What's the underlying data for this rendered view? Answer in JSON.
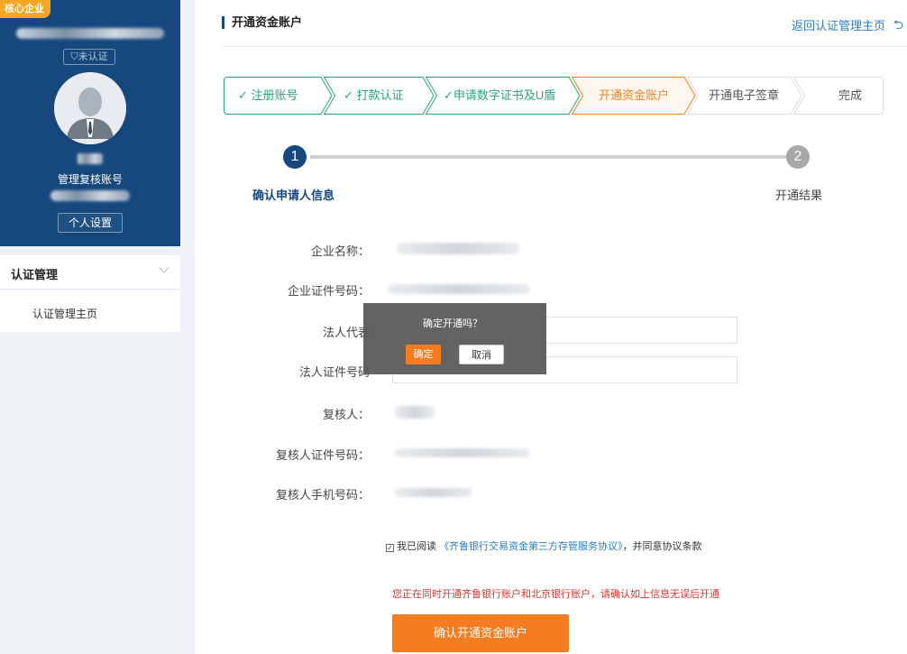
{
  "sidebar": {
    "badge": "核心企业",
    "cert_status": "未认证",
    "role_name": "管理复核账号",
    "settings_label": "个人设置",
    "menu_group": "认证管理",
    "menu_item": "认证管理主页"
  },
  "header": {
    "title": "开通资金账户",
    "back_link": "返回认证管理主页"
  },
  "steps": [
    {
      "label": "注册账号",
      "state": "done"
    },
    {
      "label": "打款认证",
      "state": "done"
    },
    {
      "label": "申请数字证书及U盾",
      "state": "done"
    },
    {
      "label": "开通资金账户",
      "state": "current"
    },
    {
      "label": "开通电子签章",
      "state": "todo"
    },
    {
      "label": "完成",
      "state": "todo"
    }
  ],
  "progress": {
    "node1": "1",
    "node2": "2",
    "label1": "确认申请人信息",
    "label2": "开通结果"
  },
  "form": {
    "company_name_label": "企业名称：",
    "company_id_label": "企业证件号码：",
    "legal_rep_label": "法人代表",
    "legal_id_label": "法人证件号码",
    "reviewer_label": "复核人：",
    "reviewer_id_label": "复核人证件号码：",
    "reviewer_phone_label": "复核人手机号码："
  },
  "agreement": {
    "prefix": "我已阅读",
    "link": "《齐鲁银行交易资金第三方存管服务协议》",
    "suffix": "，并同意协议条款"
  },
  "warning": "您正在同时开通齐鲁银行账户和北京银行账户，请确认如上信息无误后开通",
  "submit_label": "确认开通资金账户",
  "popover": {
    "message": "确定开通吗？",
    "ok_label": "确定",
    "cancel_label": "取消"
  },
  "colors": {
    "brand": "#16477d",
    "accent": "#f57c1f",
    "done": "#27a57b",
    "link": "#2a7fc9",
    "warning": "#e0312b"
  }
}
